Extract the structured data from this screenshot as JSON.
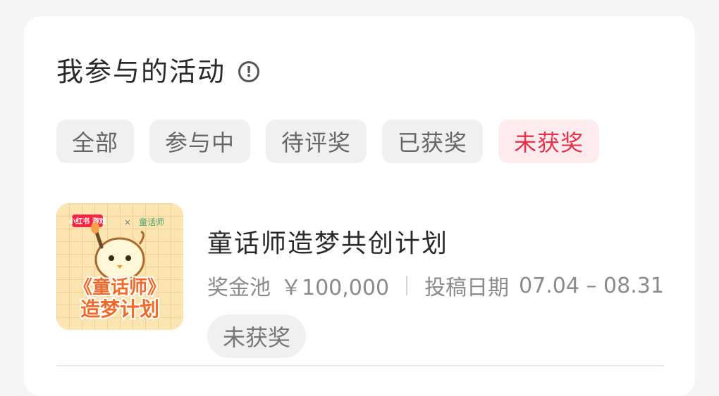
{
  "section": {
    "title": "我参与的活动"
  },
  "tabs": [
    {
      "label": "全部"
    },
    {
      "label": "参与中"
    },
    {
      "label": "待评奖"
    },
    {
      "label": "已获奖"
    },
    {
      "label": "未获奖"
    }
  ],
  "activity": {
    "title": "童话师造梦共创计划",
    "prize_label": "奖金池",
    "prize_value": "￥100,000",
    "date_label": "投稿日期",
    "date_range": "07.04 – 08.31",
    "status": "未获奖",
    "thumbnail": {
      "brand_left": "小红书 游戏",
      "times": "×",
      "brand_right": "童话师",
      "line1": "《童话师》",
      "line2": "造梦计划"
    }
  },
  "colors": {
    "accent": "#e6314a",
    "accent_bg": "#fdecee"
  }
}
